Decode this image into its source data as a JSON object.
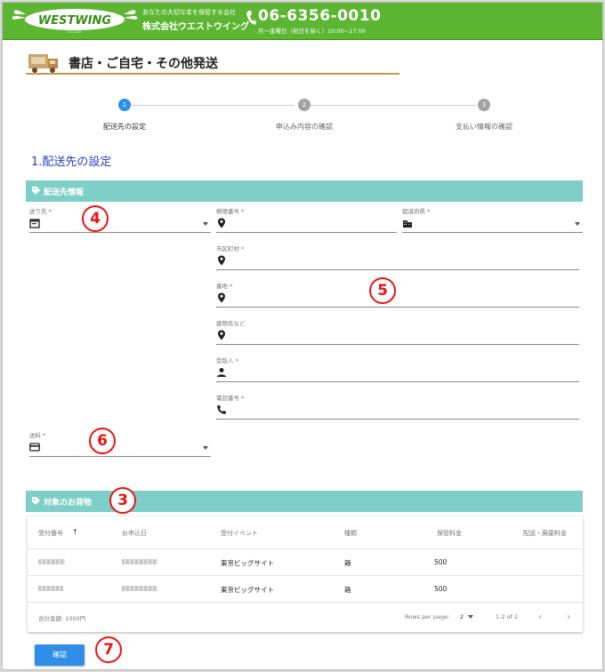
{
  "header": {
    "tagline": "あなたの大切な本を保管する会社",
    "company": "株式会社ウエストウイング",
    "phone": "06-6356-0010",
    "hours": "月～金曜日（祝日を除く）10:00~17:00",
    "brand_color": "#5cb632"
  },
  "page": {
    "title": "書店・ご自宅・その他発送"
  },
  "stepper": {
    "steps": [
      {
        "number": "1",
        "label": "配送先の設定",
        "active": true
      },
      {
        "number": "2",
        "label": "申込み内容の確認",
        "active": false
      },
      {
        "number": "3",
        "label": "支払い情報の確認",
        "active": false
      }
    ]
  },
  "section_heading": "1.配送先の設定",
  "shipping": {
    "bar_title": "配送先情報",
    "fields": {
      "destination": {
        "label": "送り先 *",
        "icon": "calendar-icon"
      },
      "postal": {
        "label": "郵便番号 *",
        "icon": "map-pin-icon"
      },
      "prefecture": {
        "label": "都道府県 *",
        "icon": "building-icon"
      },
      "city": {
        "label": "市区町村 *",
        "icon": "map-pin-icon"
      },
      "address": {
        "label": "番地 *",
        "icon": "map-pin-icon"
      },
      "building": {
        "label": "建物名など",
        "icon": "map-pin-icon"
      },
      "recipient": {
        "label": "受取人 *",
        "icon": "person-icon"
      },
      "tel": {
        "label": "電話番号 *",
        "icon": "phone-icon"
      },
      "fee": {
        "label": "送料 *",
        "icon": "card-icon"
      }
    }
  },
  "items": {
    "bar_title": "対象のお荷物",
    "columns": [
      "受付番号",
      "お申込日",
      "受付イベント",
      "種類",
      "保管料金",
      "配送・廃棄料金"
    ],
    "sort_indicator": "↑",
    "rows": [
      {
        "event": "東京ビッグサイト",
        "type": "箱",
        "fee": "500"
      },
      {
        "event": "東京ビッグサイト",
        "type": "箱",
        "fee": "500"
      }
    ],
    "total": "合計金額: 1000円",
    "rows_per_page_label": "Rows per page:",
    "rows_per_page": "2",
    "range": "1-2 of 2"
  },
  "markers": [
    "4",
    "5",
    "6",
    "3",
    "7"
  ],
  "confirm_button": "確認",
  "accent_teal": "#7ecfc7",
  "accent_blue": "#2f8ee8"
}
